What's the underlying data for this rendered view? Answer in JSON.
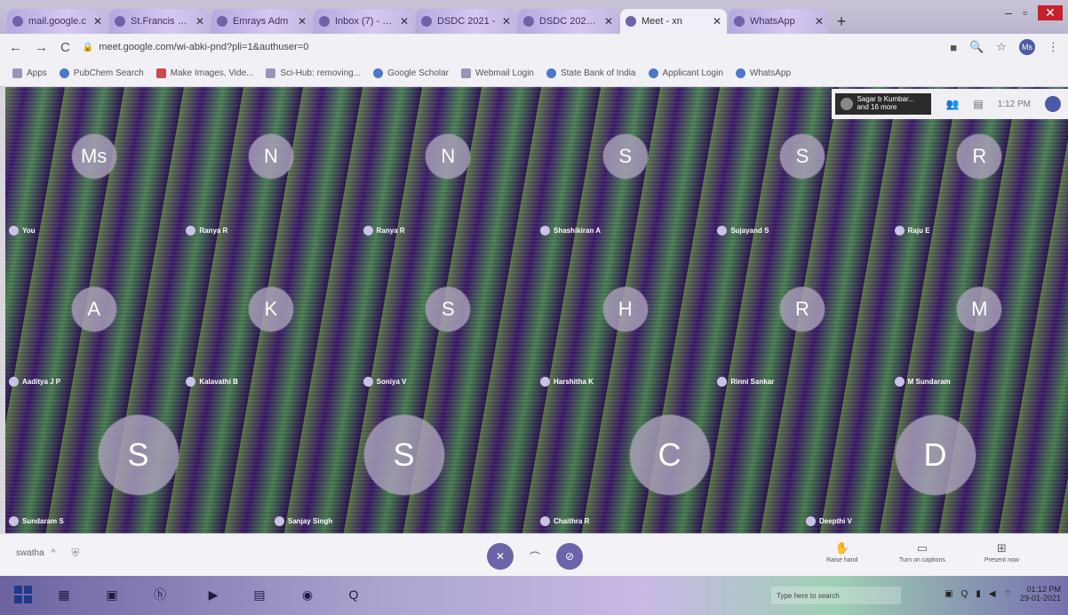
{
  "browser": {
    "tabs": [
      {
        "label": "mail.google.c",
        "active": false
      },
      {
        "label": "St.Francis de S",
        "active": false
      },
      {
        "label": "Emrays Adm",
        "active": false
      },
      {
        "label": "Inbox (7) - swa",
        "active": false
      },
      {
        "label": "DSDC 2021 -",
        "active": false
      },
      {
        "label": "DSDC 2021_V",
        "active": false
      },
      {
        "label": "Meet - xn",
        "active": true
      },
      {
        "label": "WhatsApp",
        "active": false
      }
    ],
    "new_tab": "+",
    "url": "meet.google.com/wi-abki-pnd?pli=1&authuser=0",
    "profile_initials": "Ms",
    "bookmarks": [
      "Apps",
      "PubChem Search",
      "Make Images, Vide...",
      "Sci-Hub: removing...",
      "Google Scholar",
      "Webmail Login",
      "State Bank of India",
      "Applicant Login",
      "WhatsApp"
    ]
  },
  "meet": {
    "join_notice_line1": "Sagar b Kumbar...",
    "join_notice_line2": "and 16 more",
    "clock": "1:12 PM",
    "participants": [
      {
        "initial": "Ms",
        "name": "You"
      },
      {
        "initial": "N",
        "name": "Ranya R"
      },
      {
        "initial": "N",
        "name": "Ranya R"
      },
      {
        "initial": "S",
        "name": "Shashikiran A"
      },
      {
        "initial": "S",
        "name": "Sujayand S"
      },
      {
        "initial": "R",
        "name": "Raju E"
      },
      {
        "initial": "A",
        "name": "Aaditya J P"
      },
      {
        "initial": "K",
        "name": "Kalavathi B"
      },
      {
        "initial": "S",
        "name": "Soniya V"
      },
      {
        "initial": "H",
        "name": "Harshitha K"
      },
      {
        "initial": "R",
        "name": "Rinni Sankar"
      },
      {
        "initial": "M",
        "name": "M Sundaram"
      },
      {
        "initial": "S",
        "name": "Sundaram S"
      },
      {
        "initial": "S",
        "name": "Sanjay Singh"
      },
      {
        "initial": "C",
        "name": "Chaithra R"
      },
      {
        "initial": "D",
        "name": "Deepthi V"
      }
    ],
    "meeting_details": "swatha",
    "raise_hand": "Raise hand",
    "captions": "Turn on captions",
    "present": "Present now"
  },
  "taskbar": {
    "search_text": "Type here to search",
    "clock_time": "01:12 PM",
    "clock_date": "29-01-2021"
  }
}
